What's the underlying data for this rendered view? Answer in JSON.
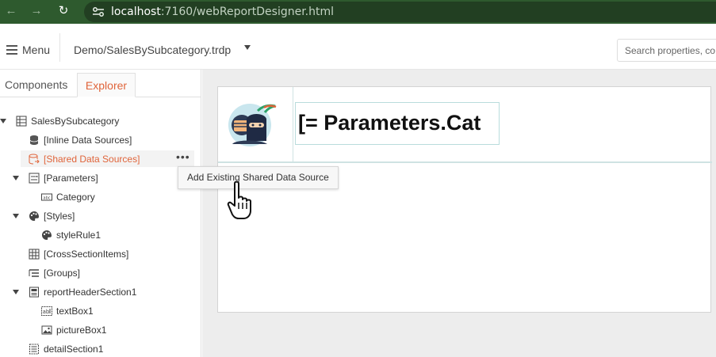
{
  "browser": {
    "url_host": "localhost",
    "url_path": ":7160/webReportDesigner.html"
  },
  "toolbar": {
    "menu_label": "Menu",
    "report_name": "Demo/SalesBySubcategory.trdp",
    "search_placeholder": "Search properties, co"
  },
  "tabs": {
    "components": "Components",
    "explorer": "Explorer"
  },
  "tree": {
    "root": "SalesBySubcategory",
    "inline_ds": "[Inline Data Sources]",
    "shared_ds": "[Shared Data Sources]",
    "parameters": "[Parameters]",
    "category": "Category",
    "styles": "[Styles]",
    "style_rule": "styleRule1",
    "cross_section": "[CrossSectionItems]",
    "groups": "[Groups]",
    "report_header": "reportHeaderSection1",
    "textbox": "textBox1",
    "picturebox": "pictureBox1",
    "detail": "detailSection1"
  },
  "context_menu": {
    "item": "Add Existing Shared Data Source"
  },
  "canvas": {
    "title_text": "[= Parameters.Cat"
  },
  "colors": {
    "accent": "#e0643a",
    "browser_bar": "#2e5a2e"
  }
}
